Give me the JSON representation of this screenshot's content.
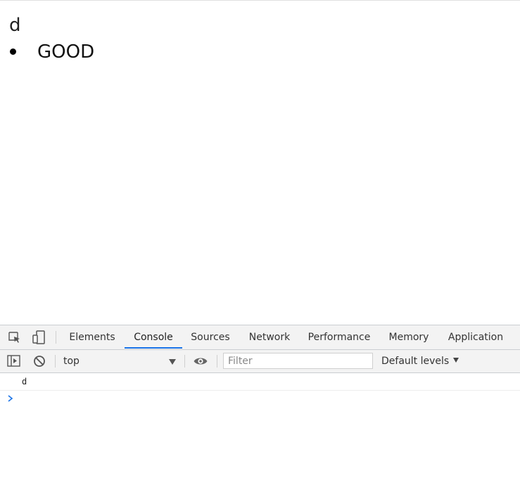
{
  "page": {
    "heading": "d",
    "list_items": [
      "GOOD"
    ]
  },
  "devtools": {
    "tabs": [
      {
        "label": "Elements"
      },
      {
        "label": "Console"
      },
      {
        "label": "Sources"
      },
      {
        "label": "Network"
      },
      {
        "label": "Performance"
      },
      {
        "label": "Memory"
      },
      {
        "label": "Application"
      }
    ],
    "active_tab": "Console",
    "toolbar": {
      "context": "top",
      "filter_placeholder": "Filter",
      "filter_value": "",
      "levels": "Default levels"
    },
    "console": {
      "logs": [
        "d"
      ],
      "prompt_value": ""
    },
    "colors": {
      "accent": "#1a73e8",
      "toolbar_bg": "#f3f3f3",
      "border": "#cacdd1"
    },
    "icons": [
      "inspect-element-icon",
      "device-toolbar-icon",
      "sidebar-toggle-icon",
      "clear-console-icon",
      "live-expression-eye-icon",
      "prompt-chevron-icon"
    ]
  }
}
